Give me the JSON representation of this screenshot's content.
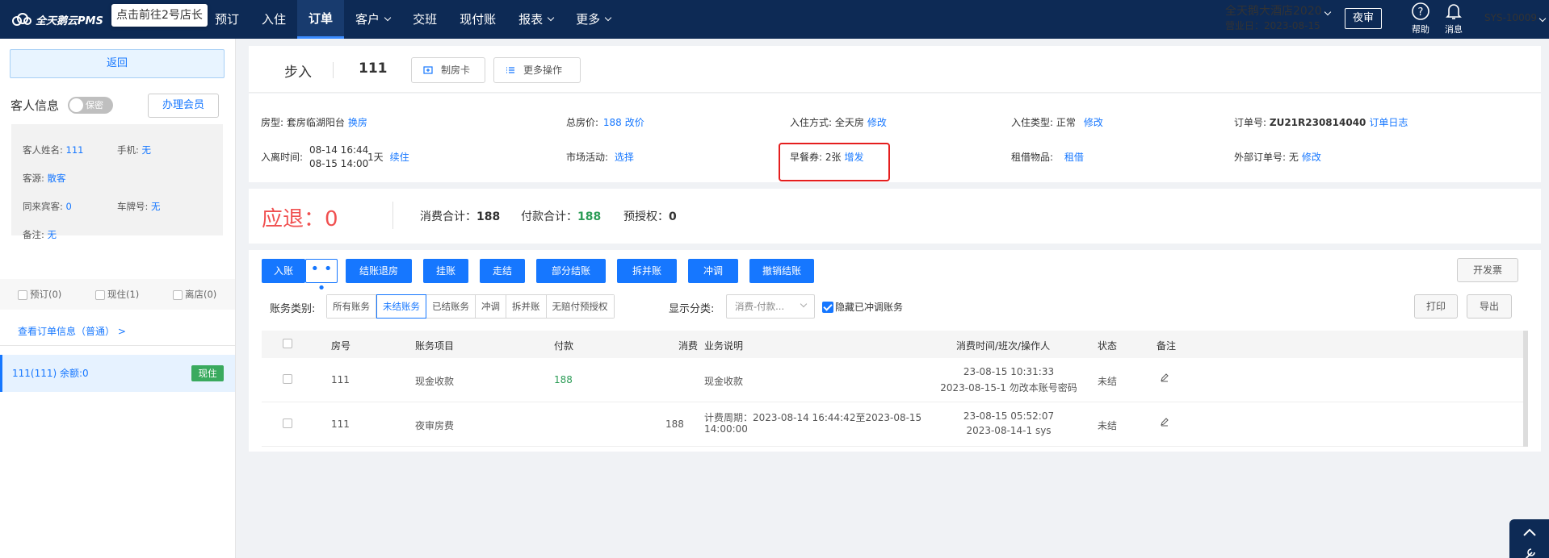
{
  "topbar": {
    "logo": "全天鹅云PMS",
    "tooltip": "点击前往2号店长",
    "nav": [
      {
        "label": "预订",
        "dropdown": false,
        "active": false
      },
      {
        "label": "入住",
        "dropdown": false,
        "active": false
      },
      {
        "label": "订单",
        "dropdown": false,
        "active": true
      },
      {
        "label": "客户",
        "dropdown": true,
        "active": false
      },
      {
        "label": "交班",
        "dropdown": false,
        "active": false
      },
      {
        "label": "现付账",
        "dropdown": false,
        "active": false
      },
      {
        "label": "报表",
        "dropdown": true,
        "active": false
      },
      {
        "label": "更多",
        "dropdown": true,
        "active": false
      }
    ],
    "hotel_name": "全天鹅大酒店2020",
    "business_date": "营业日：2023-08-15",
    "night_audit": "夜审",
    "help": "帮助",
    "messages": "消息",
    "user": "SYS-10009"
  },
  "left": {
    "back": "返回",
    "guest_info_title": "客人信息",
    "secret_toggle": "保密",
    "member_button": "办理会员",
    "guest": {
      "name_label": "客人姓名:",
      "name": "111",
      "phone_label": "手机:",
      "phone": "无",
      "source_label": "客源:",
      "source": "散客",
      "companions_label": "同来宾客:",
      "companions": "0",
      "plate_label": "车牌号:",
      "plate": "无",
      "remark_label": "备注:",
      "remark": "无"
    },
    "filters": [
      "预订(0)",
      "现住(1)",
      "离店(0)"
    ],
    "view_order": "查看订单信息（普通）  >",
    "room_item": "111(111)   余额:0",
    "room_badge": "现住"
  },
  "order": {
    "type": "步入",
    "room": "111",
    "make_card": "制房卡",
    "more_ops": "更多操作",
    "info": {
      "room_type_label": "房型:",
      "room_type": "套房临湖阳台",
      "room_type_action": "换房",
      "total_price_label": "总房价:",
      "total_price": "188",
      "total_price_action": "改价",
      "checkin_method_label": "入住方式:",
      "checkin_method": "全天房",
      "checkin_method_action": "修改",
      "checkin_type_label": "入住类型:",
      "checkin_type": "正常",
      "checkin_type_action": "修改",
      "order_no_label": "订单号:",
      "order_no": "ZU21R230814040",
      "order_log": "订单日志",
      "stay_label": "入离时间:",
      "arrive": "08-14 16:44",
      "depart": "08-15 14:00",
      "nights": "1天",
      "extend": "续住",
      "market_label": "市场活动:",
      "market_action": "选择",
      "breakfast_label": "早餐券:",
      "breakfast_value": "2张",
      "breakfast_action": "增发",
      "rental_label": "租借物品:",
      "rental_action": "租借",
      "external_label": "外部订单号:",
      "external_value": "无",
      "external_action": "修改"
    }
  },
  "summary": {
    "refund_label": "应退：",
    "refund_value": "0",
    "consume_label": "消费合计：",
    "consume_value": "188",
    "pay_label": "付款合计：",
    "pay_value": "188",
    "preauth_label": "预授权：",
    "preauth_value": "0"
  },
  "ledger": {
    "toolbar": [
      "入账",
      "结账退房",
      "挂账",
      "走结",
      "部分结账",
      "拆并账",
      "冲调",
      "撤销结账"
    ],
    "more_dots": "• • •",
    "invoice": "开发票",
    "print": "打印",
    "export": "导出",
    "account_type_label": "账务类别:",
    "account_types": [
      "所有账务",
      "未结账务",
      "已结账务",
      "冲调",
      "拆并账",
      "无赔付预授权"
    ],
    "active_account_type": 1,
    "display_label": "显示分类:",
    "display_select": "消费-付款...",
    "hide_label": "隐藏已冲调账务",
    "columns": [
      "房号",
      "账务项目",
      "付款",
      "消费",
      "业务说明",
      "消费时间/班次/操作人",
      "状态",
      "备注"
    ],
    "rows": [
      {
        "room": "111",
        "item": "现金收款",
        "pay": "188",
        "consume": "",
        "desc1": "现金收款",
        "desc2": "",
        "time1": "23-08-15 10:31:33",
        "time2": "2023-08-15-1 勿改本账号密码",
        "status": "未结"
      },
      {
        "room": "111",
        "item": "夜审房费",
        "pay": "",
        "consume": "188",
        "desc1": "计费周期：2023-08-14 16:44:42至2023-08-15",
        "desc2": "14:00:00",
        "time1": "23-08-15 05:52:07",
        "time2": "2023-08-14-1 sys",
        "status": "未结"
      }
    ]
  },
  "colors": {
    "topbar": "#0d2a55",
    "accent": "#1677ff",
    "refund": "#f05050",
    "green": "#2e9d58",
    "highlight": "#e51e1e"
  }
}
